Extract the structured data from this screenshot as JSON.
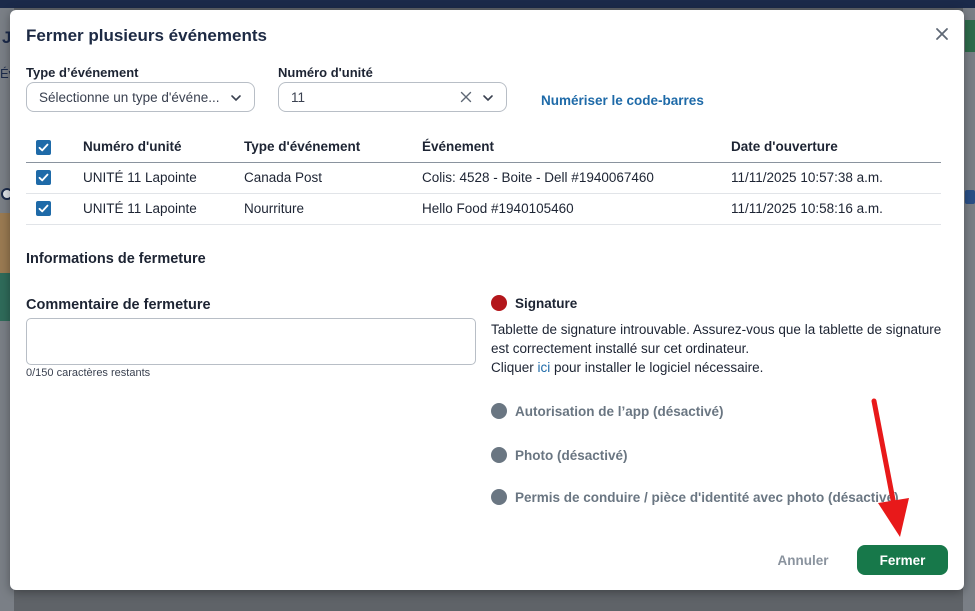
{
  "background": {
    "left_title": "Je",
    "left_tab": "Év"
  },
  "modal": {
    "title": "Fermer plusieurs événements"
  },
  "filters": {
    "event_type_label": "Type d’événement",
    "event_type_value": "Sélectionne un type d'événe...",
    "unit_label": "Numéro d'unité",
    "unit_value": "11",
    "scan_barcode_label": "Numériser le code-barres"
  },
  "table": {
    "headers": [
      "Numéro d'unité",
      "Type d'événement",
      "Événement",
      "Date d'ouverture"
    ],
    "rows": [
      {
        "unit": "UNITÉ 11 Lapointe",
        "type": "Canada Post",
        "event": "Colis: 4528 - Boite - Dell #1940067460",
        "date": "11/11/2025 10:57:38 a.m."
      },
      {
        "unit": "UNITÉ 11 Lapointe",
        "type": "Nourriture",
        "event": "Hello Food #1940105460",
        "date": "11/11/2025 10:58:16 a.m."
      }
    ]
  },
  "closing": {
    "section_title": "Informations de fermeture",
    "comment_label": "Commentaire de fermeture",
    "char_count": "0/150 caractères restants"
  },
  "signature": {
    "options": [
      {
        "label": "Signature",
        "state": "active"
      },
      {
        "label": "Autorisation de l’app (désactivé)",
        "state": "disabled"
      },
      {
        "label": "Photo (désactivé)",
        "state": "disabled"
      },
      {
        "label": "Permis de conduire / pièce d'identité avec photo (désactivé)",
        "state": "disabled"
      }
    ],
    "message_line1": "Tablette de signature introuvable. Assurez-vous que la tablette de signature est correctement installé sur cet ordinateur.",
    "message_prefix": "Cliquer ",
    "message_link": "ici",
    "message_suffix": " pour installer le logiciel nécessaire."
  },
  "actions": {
    "cancel_label": "Annuler",
    "close_label": "Fermer"
  },
  "colors": {
    "primary_blue": "#1e6aa8",
    "confirm_green": "#17784a",
    "signature_red": "#b3161b",
    "disabled_gray": "#6a7682",
    "annotation_arrow": "#e8191a"
  },
  "icons": {
    "close": "close-icon",
    "dropdown": "chevron-down-icon",
    "clear": "clear-icon",
    "checkbox": "checkbox-checked-icon",
    "annotation": "red-arrow-annotation-icon"
  }
}
